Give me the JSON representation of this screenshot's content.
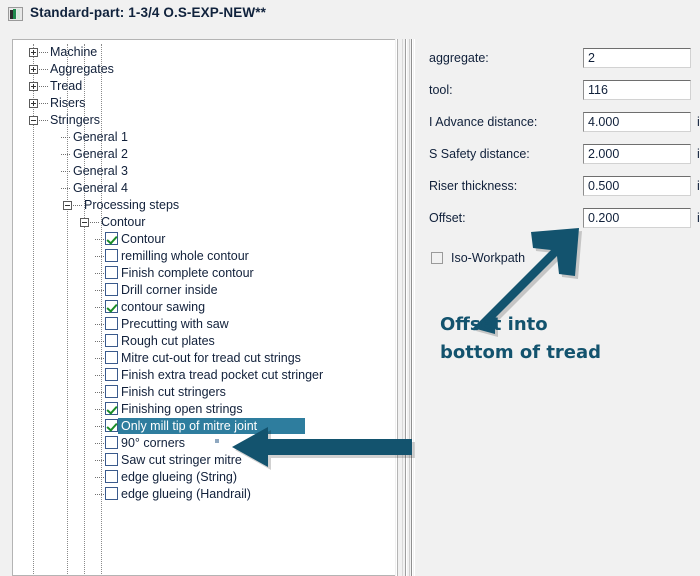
{
  "window": {
    "title": "Standard-part: 1-3/4  O.S-EXP-NEW**",
    "icon": "application-icon"
  },
  "colors": {
    "selection": "#2e7d9e",
    "annotation": "#13536e",
    "checkmark": "#1a8c28",
    "panel_background": "#f1f1f1",
    "tree_background": "#ffffff"
  },
  "tree": {
    "nodes": [
      {
        "label": "Machine",
        "indent": 0,
        "type": "expander",
        "state": "collapsed"
      },
      {
        "label": "Aggregates",
        "indent": 0,
        "type": "expander",
        "state": "collapsed"
      },
      {
        "label": "Tread",
        "indent": 0,
        "type": "expander",
        "state": "collapsed"
      },
      {
        "label": "Risers",
        "indent": 0,
        "type": "expander",
        "state": "collapsed"
      },
      {
        "label": "Stringers",
        "indent": 0,
        "type": "expander",
        "state": "expanded"
      },
      {
        "label": "General  1",
        "indent": 1,
        "type": "leaf",
        "state": "none"
      },
      {
        "label": "General  2",
        "indent": 1,
        "type": "leaf",
        "state": "none"
      },
      {
        "label": "General  3",
        "indent": 1,
        "type": "leaf",
        "state": "none"
      },
      {
        "label": "General  4",
        "indent": 1,
        "type": "leaf",
        "state": "none"
      },
      {
        "label": "Processing steps",
        "indent": 1,
        "type": "expander",
        "state": "expanded"
      },
      {
        "label": "Contour",
        "indent": 2,
        "type": "expander",
        "state": "expanded"
      },
      {
        "label": "Contour",
        "indent": 3,
        "type": "checkbox",
        "checked": true,
        "selected": false
      },
      {
        "label": "remilling whole contour",
        "indent": 3,
        "type": "checkbox",
        "checked": false,
        "selected": false
      },
      {
        "label": "Finish complete contour",
        "indent": 3,
        "type": "checkbox",
        "checked": false,
        "selected": false
      },
      {
        "label": "Drill corner inside",
        "indent": 3,
        "type": "checkbox",
        "checked": false,
        "selected": false
      },
      {
        "label": "contour sawing",
        "indent": 3,
        "type": "checkbox",
        "checked": true,
        "selected": false
      },
      {
        "label": "Precutting with saw",
        "indent": 3,
        "type": "checkbox",
        "checked": false,
        "selected": false
      },
      {
        "label": "Rough cut plates",
        "indent": 3,
        "type": "checkbox",
        "checked": false,
        "selected": false
      },
      {
        "label": "Mitre cut-out for tread cut strings",
        "indent": 3,
        "type": "checkbox",
        "checked": false,
        "selected": false
      },
      {
        "label": "Finish extra tread pocket cut stringer",
        "indent": 3,
        "type": "checkbox",
        "checked": false,
        "selected": false
      },
      {
        "label": "Finish cut stringers",
        "indent": 3,
        "type": "checkbox",
        "checked": false,
        "selected": false
      },
      {
        "label": "Finishing open strings",
        "indent": 3,
        "type": "checkbox",
        "checked": true,
        "selected": false
      },
      {
        "label": "Only mill tip of mitre joint",
        "indent": 3,
        "type": "checkbox",
        "checked": true,
        "selected": true
      },
      {
        "label": "90° corners",
        "indent": 3,
        "type": "checkbox",
        "checked": false,
        "selected": false
      },
      {
        "label": "Saw cut stringer mitre",
        "indent": 3,
        "type": "checkbox",
        "checked": false,
        "selected": false
      },
      {
        "label": "edge glueing  (String)",
        "indent": 3,
        "type": "checkbox",
        "checked": false,
        "selected": false
      },
      {
        "label": "edge glueing  (Handrail)",
        "indent": 3,
        "type": "checkbox",
        "checked": false,
        "selected": false
      }
    ]
  },
  "properties": {
    "fields": [
      {
        "label": "aggregate:",
        "value": "2",
        "unit": ""
      },
      {
        "label": "tool:",
        "value": "116",
        "unit": ""
      },
      {
        "label": "I  Advance distance:",
        "value": "4.000",
        "unit": "in"
      },
      {
        "label": "S  Safety distance:",
        "value": "2.000",
        "unit": "in"
      },
      {
        "label": "Riser thickness:",
        "value": "0.500",
        "unit": "in"
      },
      {
        "label": "Offset:",
        "value": "0.200",
        "unit": "in"
      }
    ],
    "iso_workpath": {
      "label": "Iso-Workpath",
      "checked": false
    }
  },
  "annotations": {
    "callout": {
      "line1": "Offset into",
      "line2": "bottom of tread"
    },
    "arrow_to_offset": "arrow-up-right-icon",
    "arrow_to_tree_item": "arrow-left-icon"
  }
}
